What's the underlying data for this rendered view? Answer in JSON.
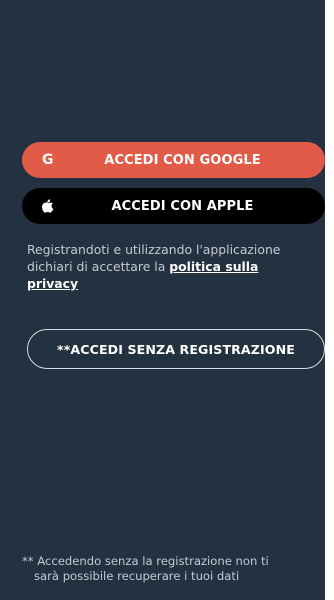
{
  "login": {
    "google_button": {
      "icon": "google-g-icon",
      "icon_glyph": "G",
      "label": "ACCEDI CON GOOGLE",
      "color": "#e25b48"
    },
    "apple_button": {
      "icon": "apple-icon",
      "label": "ACCEDI CON APPLE",
      "color": "#000000"
    },
    "privacy_notice": {
      "text": "Registrandoti e utilizzando l'applicazione dichiari di accettare la ",
      "link_part1": "politica sulla",
      "link_part2": "privacy"
    },
    "guest_button": {
      "label": "**ACCEDI SENZA REGISTRAZIONE"
    },
    "footnote": {
      "line1": "** Accedendo senza la registrazione non ti",
      "line2": "sarà possibile recuperare i tuoi dati"
    }
  },
  "colors": {
    "background": "#243140",
    "text_muted": "#c3cad3"
  }
}
